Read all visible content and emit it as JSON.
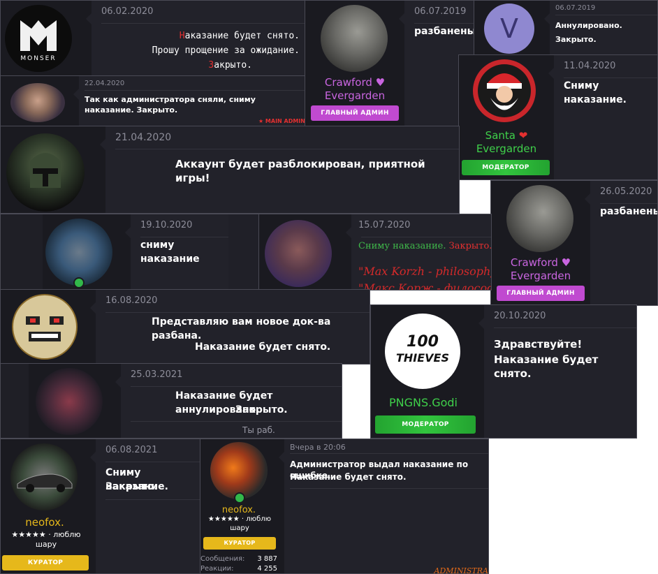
{
  "colors": {
    "card": "#202028",
    "green_name": "#3fd04a",
    "pink_name": "#c965e0",
    "pink_rank": "#c04ad0",
    "green_rank": "#29b036",
    "yellow_rank": "#e6b81b",
    "red": "#e33030"
  },
  "c1": {
    "date": "06.02.2020",
    "line1_first": "Н",
    "line1_rest": "аказание будет снято.",
    "line2": "Прошу прощение за ожидание.",
    "line3_first": "З",
    "line3_rest": "акрыто.",
    "logo_text": "MONSER"
  },
  "c2": {
    "date": "06.07.2019",
    "text": "разбанены",
    "name": "Crawford ♥ Evergarden",
    "rank": "ГЛАВНЫЙ АДМИН"
  },
  "c3": {
    "date": "06.07.2019",
    "text": "Аннулировано. Закрыто.",
    "avatar_letter": "V"
  },
  "c4": {
    "date": "22.04.2020",
    "text": "Так как администратора сняли, сниму наказание. Закрыто.",
    "sig": "★ MAIN ADMIN"
  },
  "c5": {
    "date": "11.04.2020",
    "text": "Сниму наказание.",
    "name_line1": "Santa",
    "name_line2": "Evergarden",
    "heart": "❤",
    "rank": "МОДЕРАТОР"
  },
  "c6": {
    "date": "21.04.2020",
    "text": "Аккаунт будет разблокирован, приятной игры!"
  },
  "c7": {
    "date": "26.05.2020",
    "text": "разбанены",
    "name": "Crawford ♥ Evergarden",
    "rank": "ГЛАВНЫЙ АДМИН"
  },
  "c8": {
    "date": "19.10.2020",
    "text": "сниму наказание"
  },
  "c9": {
    "date": "15.07.2020",
    "text_green": "Сниму наказание.",
    "text_red": "Закрыто.",
    "quote1": "\"Max Korzh - philosophy",
    "quote2": "\"Макс Корж - философ"
  },
  "c10": {
    "date": "16.08.2020",
    "line1": "Представляю вам новое док-ва разбана.",
    "line2": "Наказание будет снято."
  },
  "c11": {
    "date": "20.10.2020",
    "line1": "Здравствуйте!",
    "line2": "Наказание будет снято.",
    "name": "PNGNS.Godi",
    "rank": "МОДЕРАТОР",
    "logo_top": "100",
    "logo_bottom": "THIEVES"
  },
  "c12": {
    "date": "25.03.2021",
    "line1": "Наказание будет аннулировано.",
    "line2": "Закрыто.",
    "sig": "Ты раб."
  },
  "c13": {
    "date": "06.08.2021",
    "line1": "Сниму наказание.",
    "line2": "Закрыто.",
    "name": "neofox.",
    "status": "★★★★★ · люблю шару",
    "rank": "КУРАТОР"
  },
  "c14": {
    "date": "Вчера в 20:06",
    "line1": "Администратор выдал наказание по ошибке.",
    "line2": "Наказание будет снято.",
    "name": "neofox.",
    "status": "★★★★★ · люблю шару",
    "rank": "КУРАТОР",
    "stat1_label": "Сообщения:",
    "stat1_value": "3 887",
    "stat2_label": "Реакции:",
    "stat2_value": "4 255",
    "sig": "ADMINISTRA"
  }
}
